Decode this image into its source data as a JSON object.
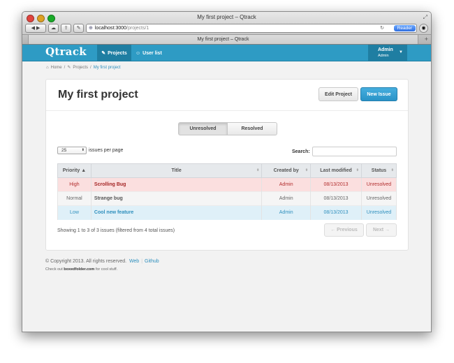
{
  "window": {
    "title": "My first project – Qtrack",
    "tab_label": "My first project – Qtrack"
  },
  "browser": {
    "url_host": "localhost:3000",
    "url_path": "/projects/1",
    "reader_label": "Reader",
    "new_tab_label": "+"
  },
  "navbar": {
    "brand": "Qtrack",
    "projects_label": "Projects",
    "users_label": "User list",
    "user_name": "Admin",
    "user_role": "Admin"
  },
  "breadcrumb": {
    "home": "Home",
    "projects": "Projects",
    "current": "My first project",
    "separator": "/"
  },
  "project": {
    "title": "My first project",
    "edit_label": "Edit Project",
    "new_issue_label": "New Issue"
  },
  "filter": {
    "unresolved": "Unresolved",
    "resolved": "Resolved"
  },
  "controls": {
    "per_page_value": "25",
    "per_page_label": "issues per page",
    "search_label": "Search:",
    "search_value": ""
  },
  "table": {
    "headers": {
      "priority": "Priority",
      "title": "Title",
      "created_by": "Created by",
      "last_modified": "Last modified",
      "status": "Status"
    },
    "rows": [
      {
        "priority": "High",
        "title": "Scrolling Bug",
        "created_by": "Admin",
        "last_modified": "08/13/2013",
        "status": "Unresolved"
      },
      {
        "priority": "Normal",
        "title": "Strange bug",
        "created_by": "Admin",
        "last_modified": "08/13/2013",
        "status": "Unresolved"
      },
      {
        "priority": "Low",
        "title": "Cool new feature",
        "created_by": "Admin",
        "last_modified": "08/13/2013",
        "status": "Unresolved"
      }
    ]
  },
  "pagination": {
    "info": "Showing 1 to 3 of 3 issues (filtered from 4 total issues)",
    "previous": "← Previous",
    "next": "Next →"
  },
  "footer": {
    "copyright": "© Copyright 2013. All rights reserved.",
    "web_link": "Web",
    "github_link": "Github",
    "note_prefix": "Check out",
    "note_site": "boxedfolder.com",
    "note_suffix": "for cool stuff."
  },
  "colors": {
    "navbar": "#2e9bc4",
    "navbar_active": "#1f7ea2",
    "primary_button": "#2a93c7",
    "high_row": "#fbdfdf",
    "low_row": "#dff0f8"
  }
}
